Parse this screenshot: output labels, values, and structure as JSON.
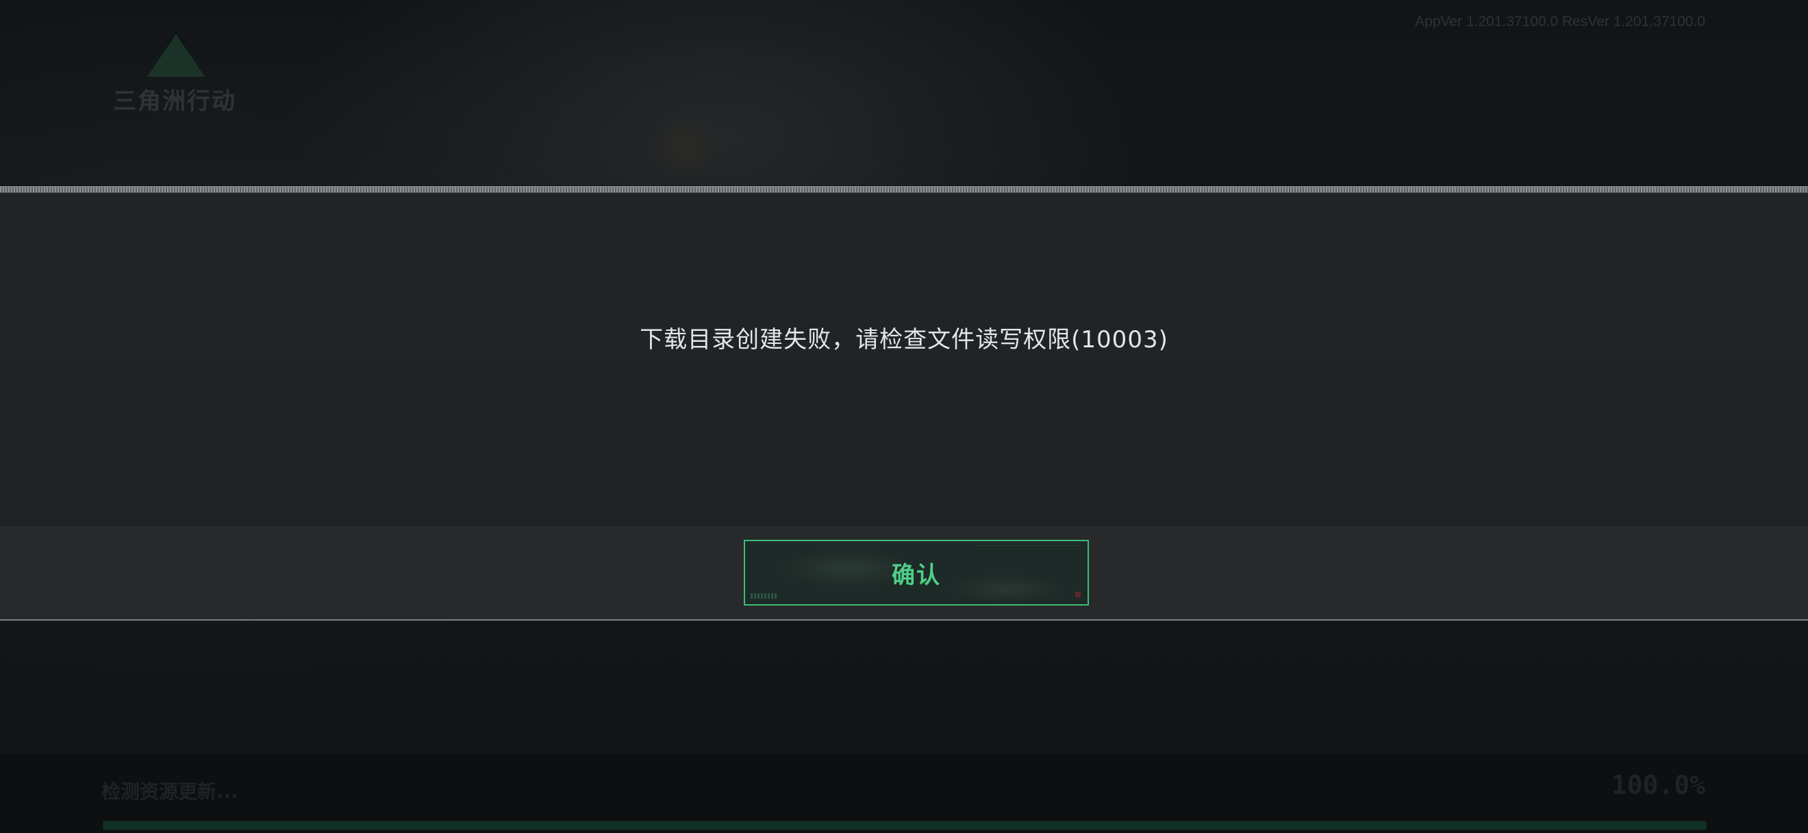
{
  "background": {
    "logo_text": "三角洲行动",
    "version": "AppVer 1.201.37100.0  ResVer 1.201.37100.0",
    "status_text": "检测资源更新...",
    "progress_percent": "100.0%",
    "progress_value": 1.0
  },
  "dialog": {
    "message": "下载目录创建失败，请检查文件读写权限(10003)",
    "confirm_label": "确认"
  },
  "colors": {
    "accent": "#4fcf87",
    "button_border": "#3fbd78",
    "dialog_bg": "#222527"
  }
}
